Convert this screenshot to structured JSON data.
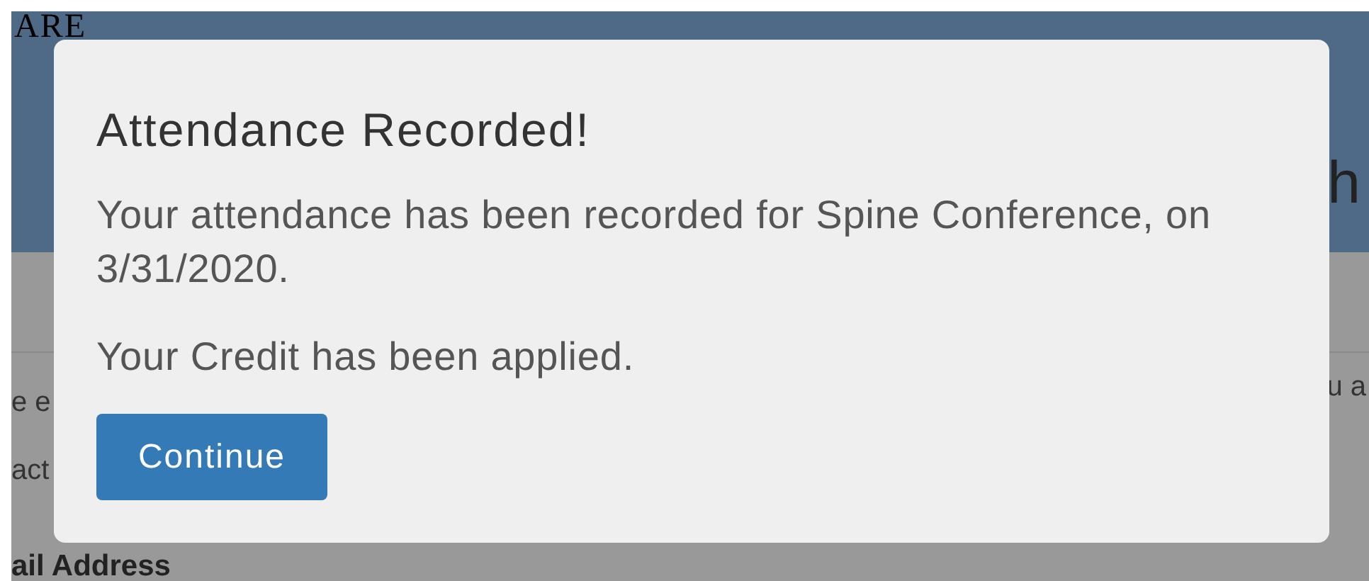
{
  "background": {
    "header_text_left": "ARE",
    "header_text_right": "h",
    "body_left_lines": [
      "e e",
      "act"
    ],
    "body_right_text": "u a",
    "field_label": "ail Address"
  },
  "dialog": {
    "title": "Attendance Recorded!",
    "message": "Your attendance has been recorded for Spine Conference, on 3/31/2020.",
    "note": "Your Credit has been applied.",
    "button": "Continue"
  }
}
